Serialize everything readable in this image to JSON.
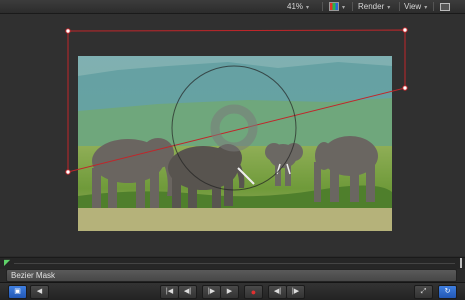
{
  "toolbar": {
    "zoom_value": "41%",
    "render_label": "Render",
    "view_label": "View",
    "zoom_arrow": "▾",
    "color_arrow": "▾",
    "render_arrow": "▾",
    "view_arrow": "▾"
  },
  "layer": {
    "name": "Bezier Mask"
  },
  "transport": {
    "toggle_icon": "▣",
    "prev_icon": "◀",
    "go_start_icon": "|◀",
    "step_back_icon": "◀|",
    "step_fwd_icon": "|▶",
    "play_icon": "▶",
    "record_icon": "●",
    "rec_opts_icon": "◉",
    "audio_icon": "◀|",
    "video_icon": "|▶",
    "fullscreen_icon": "⤢",
    "loop_icon": "↻"
  },
  "icons": {
    "color_channels": "rgb-swatch-icon",
    "window": "window-layout-icon"
  },
  "colors": {
    "mask_outline": "#c0262a",
    "accent_blue": "#2f6fd6"
  }
}
